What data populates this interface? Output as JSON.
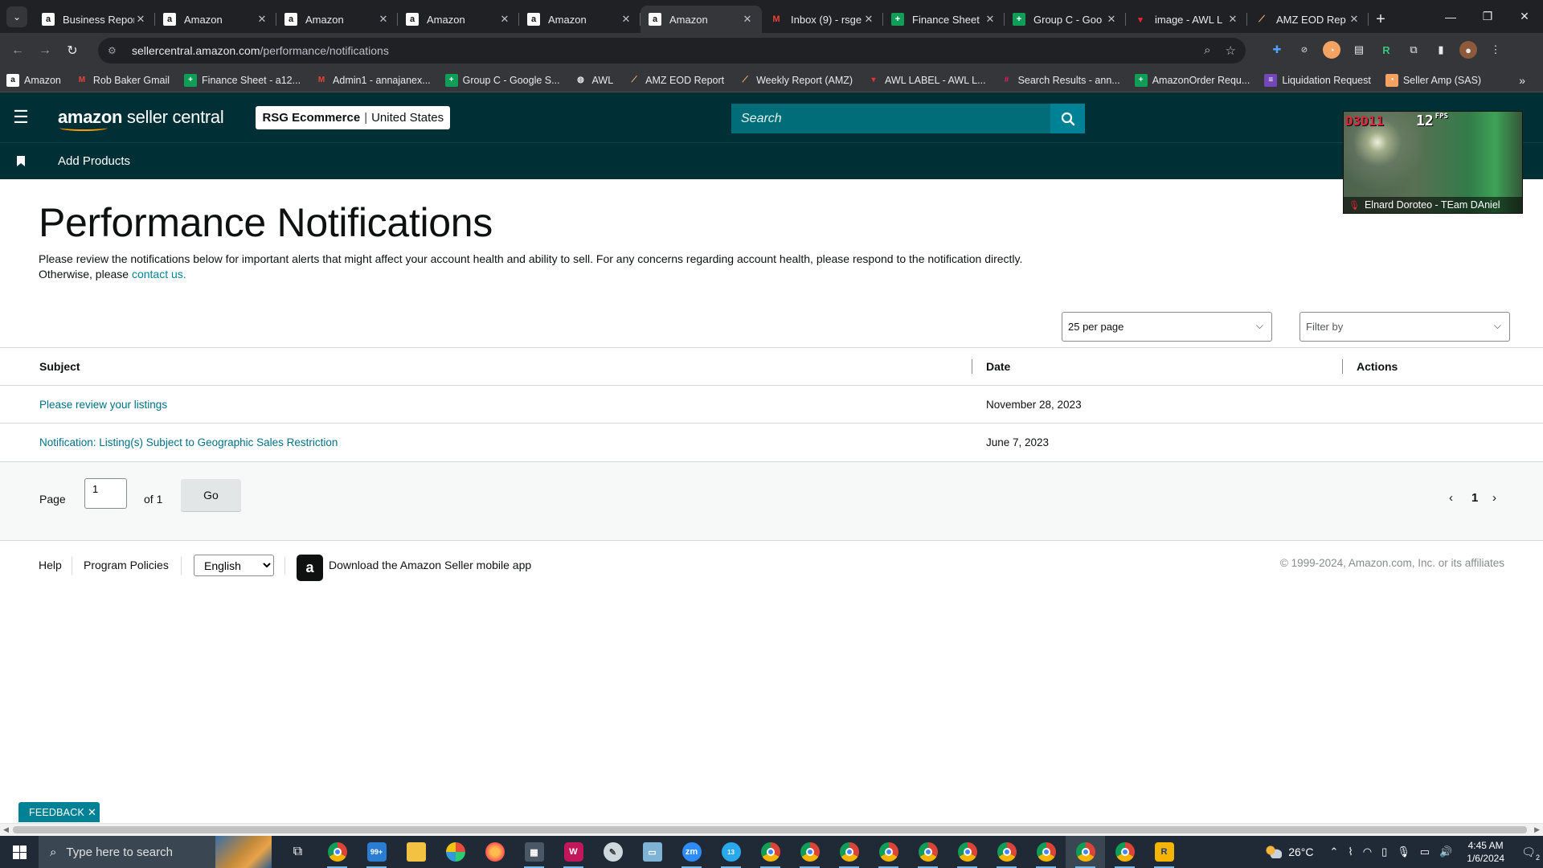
{
  "browser": {
    "tabs": [
      {
        "title": "Business Repor",
        "favicon": "amazon-icon",
        "active": false
      },
      {
        "title": "Amazon",
        "favicon": "amazon-icon",
        "active": false
      },
      {
        "title": "Amazon",
        "favicon": "amazon-icon",
        "active": false
      },
      {
        "title": "Amazon",
        "favicon": "amazon-icon",
        "active": false
      },
      {
        "title": "Amazon",
        "favicon": "amazon-icon",
        "active": false
      },
      {
        "title": "Amazon",
        "favicon": "amazon-icon",
        "active": true
      },
      {
        "title": "Inbox (9) - rsge",
        "favicon": "gmail-icon",
        "active": false
      },
      {
        "title": "Finance Sheet",
        "favicon": "sheets-icon",
        "active": false
      },
      {
        "title": "Group C - Goo",
        "favicon": "sheets-icon",
        "active": false
      },
      {
        "title": "image - AWL L",
        "favicon": "awl-icon",
        "active": false
      },
      {
        "title": "AMZ EOD Rep",
        "favicon": "eod-icon",
        "active": false
      }
    ],
    "url_host": "sellercentral.amazon.com",
    "url_path": "/performance/notifications",
    "bookmarks": [
      {
        "label": "Amazon",
        "icon": "amazon-icon",
        "bg": "#ffffff",
        "fg": "#111111",
        "glyph": "a"
      },
      {
        "label": "Rob Baker Gmail",
        "icon": "gmail-icon",
        "bg": "transparent",
        "fg": "#ea4335",
        "glyph": "M"
      },
      {
        "label": "Finance Sheet - a12...",
        "icon": "sheets-icon",
        "bg": "#0f9d58",
        "fg": "#ffffff",
        "glyph": "+"
      },
      {
        "label": "Admin1 - annajanex...",
        "icon": "gmail-icon",
        "bg": "transparent",
        "fg": "#ea4335",
        "glyph": "M"
      },
      {
        "label": "Group C - Google S...",
        "icon": "sheets-icon",
        "bg": "#0f9d58",
        "fg": "#ffffff",
        "glyph": "+"
      },
      {
        "label": "AWL",
        "icon": "globe-icon",
        "bg": "transparent",
        "fg": "#e8eaed",
        "glyph": "◍"
      },
      {
        "label": "AMZ EOD Report",
        "icon": "eod-icon",
        "bg": "transparent",
        "fg": "#f6b26b",
        "glyph": "⟋"
      },
      {
        "label": "Weekly Report (AMZ)",
        "icon": "eod-icon",
        "bg": "transparent",
        "fg": "#f6b26b",
        "glyph": "⟋"
      },
      {
        "label": "AWL LABEL - AWL L...",
        "icon": "awl-icon",
        "bg": "transparent",
        "fg": "#e23333",
        "glyph": "▾"
      },
      {
        "label": "Search Results - ann...",
        "icon": "slack-icon",
        "bg": "transparent",
        "fg": "#e01e5a",
        "glyph": "#"
      },
      {
        "label": "AmazonOrder Requ...",
        "icon": "sheets-icon",
        "bg": "#0f9d58",
        "fg": "#ffffff",
        "glyph": "+"
      },
      {
        "label": "Liquidation Request",
        "icon": "forms-icon",
        "bg": "#7248b9",
        "fg": "#ffffff",
        "glyph": "≡"
      },
      {
        "label": "Seller Amp (SAS)",
        "icon": "selleramp-icon",
        "bg": "#f4a261",
        "fg": "#ffffff",
        "glyph": "◔"
      }
    ]
  },
  "header": {
    "logo_prefix": "amazon",
    "logo_suffix": "seller central",
    "store_name": "RSG Ecommerce",
    "store_region": "United States",
    "search_placeholder": "Search",
    "nav_link": "Add Products"
  },
  "overlay": {
    "api_label": "D3D11",
    "fps_value": "12",
    "fps_unit": "FPS",
    "participant": "Elnard Doroteo - TEam DAniel"
  },
  "main": {
    "title": "Performance Notifications",
    "intro_text": "Please review the notifications below for important alerts that might affect your account health and ability to sell. For any concerns regarding account health, please respond to the notification directly. Otherwise, please ",
    "contact_link": "contact us.",
    "per_page": "25 per page",
    "filter_placeholder": "Filter by",
    "columns": [
      "Subject",
      "Date",
      "Actions"
    ],
    "rows": [
      {
        "subject": "Please review your listings",
        "date": "November 28, 2023"
      },
      {
        "subject": "Notification: Listing(s) Subject to Geographic Sales Restriction",
        "date": "June 7, 2023"
      }
    ],
    "pager": {
      "page_label": "Page",
      "page_value": "1",
      "of_label": "of 1",
      "go_label": "Go",
      "current_page": "1"
    }
  },
  "footer": {
    "help": "Help",
    "policies": "Program Policies",
    "language": "English",
    "app_text": "Download the Amazon Seller mobile app",
    "copyright": "© 1999-2024, Amazon.com, Inc. or its affiliates"
  },
  "feedback_label": "FEEDBACK",
  "taskbar": {
    "search_placeholder": "Type here to search",
    "mail_badge": "99+",
    "telegram_badge": "13",
    "temperature": "26°C",
    "time": "4:45 AM",
    "date": "1/6/2024",
    "notification_count": "2"
  }
}
